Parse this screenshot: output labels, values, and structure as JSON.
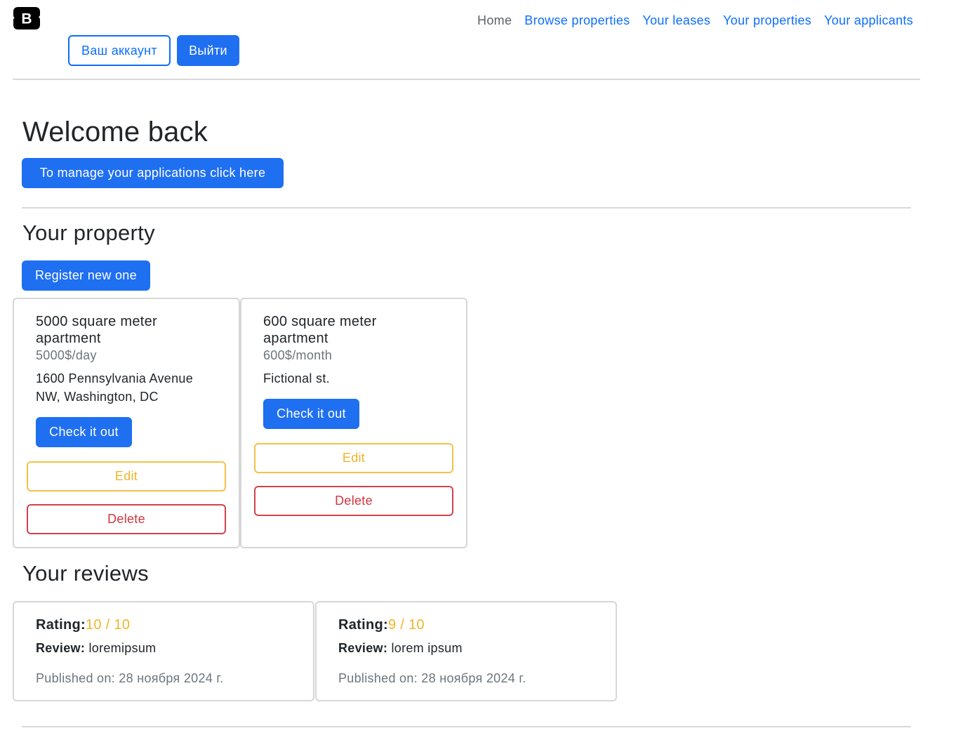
{
  "brand": {
    "logo_letter": "B"
  },
  "nav": {
    "home": "Home",
    "browse": "Browse properties",
    "leases": "Your leases",
    "properties": "Your properties",
    "applicants": "Your applicants"
  },
  "account": {
    "account_label": "Ваш аккаунт",
    "logout_label": "Выйти"
  },
  "welcome": {
    "title": "Welcome back",
    "manage_label": "To manage your applications click here"
  },
  "property_section": {
    "title": "Your property",
    "register_label": "Register new one",
    "cards": [
      {
        "title": "5000 square meter apartment",
        "price": "5000$/day",
        "address": "1600 Pennsylvania Avenue NW, Washington, DC",
        "check_label": "Check it out",
        "edit_label": "Edit",
        "delete_label": "Delete"
      },
      {
        "title": "600 square meter apartment",
        "price": "600$/month",
        "address": "Fictional st.",
        "check_label": "Check it out",
        "edit_label": "Edit",
        "delete_label": "Delete"
      }
    ]
  },
  "reviews_section": {
    "title": "Your reviews",
    "rating_label": "Rating:",
    "review_label": "Review:",
    "items": [
      {
        "score": "10 / 10",
        "text": "loremipsum",
        "published": "Published on: 28 ноября 2024 г."
      },
      {
        "score": "9 / 10",
        "text": "lorem ipsum",
        "published": "Published on: 28 ноября 2024 г."
      }
    ]
  },
  "colors": {
    "primary": "#1f6ff1",
    "warning": "#f0b429",
    "danger": "#d1353f",
    "muted": "#6c757d"
  }
}
